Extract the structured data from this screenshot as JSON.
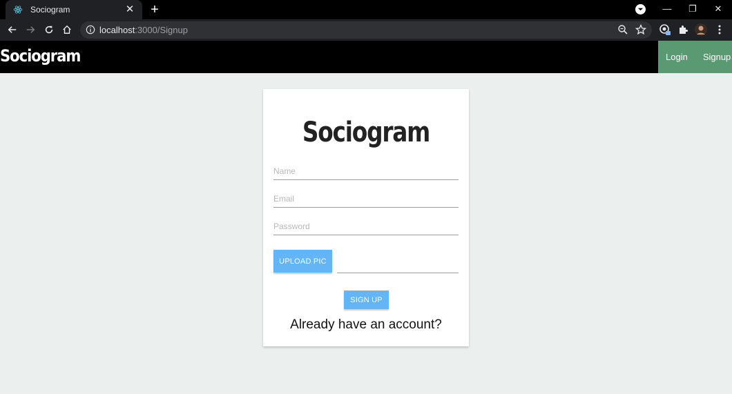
{
  "browser": {
    "tab_title": "Sociogram",
    "tab_close": "✕",
    "new_tab": "+",
    "url_host": "localhost",
    "url_rest": ":3000/Signup",
    "window_controls": {
      "minimize": "—",
      "restore": "❐",
      "close": "✕"
    }
  },
  "navbar": {
    "brand": "Sociogram",
    "links": {
      "login": "Login",
      "signup": "Signup"
    },
    "link_bg_color": "#5a9a73"
  },
  "card": {
    "title": "Sociogram",
    "name_placeholder": "Name",
    "email_placeholder": "Email",
    "password_placeholder": "Password",
    "upload_label": "UPLOAD PIC",
    "signup_label": "SIGN UP",
    "already_text": "Already have an account?",
    "button_color": "#64b5f6"
  }
}
